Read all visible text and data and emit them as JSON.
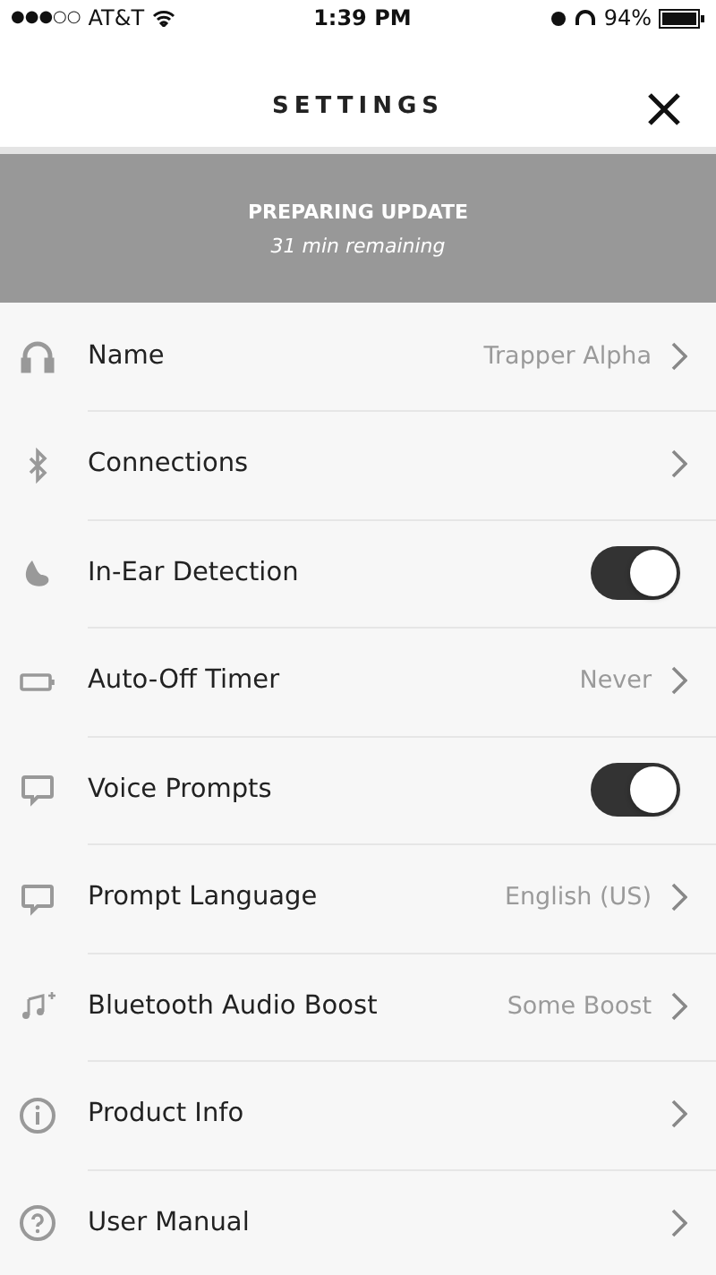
{
  "status_bar": {
    "signal": "●●●○○",
    "carrier": "AT&T",
    "time": "1:39 PM",
    "battery": "94%"
  },
  "header": {
    "title": "SETTINGS"
  },
  "banner": {
    "title": "PREPARING UPDATE",
    "subtitle": "31 min remaining"
  },
  "settings": [
    {
      "label": "Name",
      "kind": "link",
      "value": "Trapper Alpha"
    },
    {
      "label": "Connections",
      "kind": "link"
    },
    {
      "label": "In-Ear Detection",
      "kind": "toggle",
      "on": true
    },
    {
      "label": "Auto-Off Timer",
      "kind": "link",
      "value": "Never"
    },
    {
      "label": "Voice Prompts",
      "kind": "toggle",
      "on": true
    },
    {
      "label": "Prompt Language",
      "kind": "link",
      "value": "English (US)"
    },
    {
      "label": "Bluetooth Audio Boost",
      "kind": "link",
      "value": "Some Boost"
    },
    {
      "label": "Product Info",
      "kind": "link"
    },
    {
      "label": "User Manual",
      "kind": "link"
    }
  ]
}
